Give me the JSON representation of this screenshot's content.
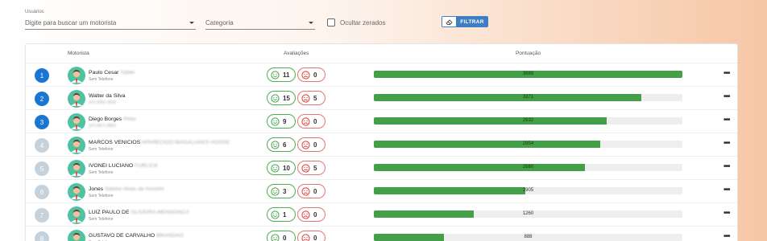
{
  "filters": {
    "users_label": "Usuários",
    "users_placeholder": "Digite para buscar um motorista",
    "category_placeholder": "Categoria",
    "hide_zero_label": "Ocultar zerados",
    "filter_button": "FILTRAR"
  },
  "table": {
    "headers": {
      "driver": "Motorista",
      "ratings": "Avaliações",
      "score": "Pontuação"
    },
    "max_score": 3889,
    "rows": [
      {
        "rank": "1",
        "name": "Paulo Cesar",
        "name_extra": "Tobler",
        "subtitle": "Sem Telefone",
        "subtitle_blurred": false,
        "good": "11",
        "bad": "0",
        "score": "3889",
        "score_value": 3889,
        "top": true
      },
      {
        "rank": "2",
        "name": "Walter da Silva",
        "name_extra": "",
        "subtitle": "(47) 9991-4520",
        "subtitle_blurred": true,
        "good": "15",
        "bad": "5",
        "score": "3371",
        "score_value": 3371,
        "top": true
      },
      {
        "rank": "3",
        "name": "Diego Borges",
        "name_extra": "Pinto",
        "subtitle": "(47) 9971-8820",
        "subtitle_blurred": true,
        "good": "9",
        "bad": "0",
        "score": "2932",
        "score_value": 2932,
        "top": true
      },
      {
        "rank": "4",
        "name": "MARCOS VENICIOS",
        "name_extra": "APARECIDO MAGALHAES HOSSE",
        "subtitle": "Sem Telefone",
        "subtitle_blurred": false,
        "good": "6",
        "bad": "0",
        "score": "2854",
        "score_value": 2854,
        "top": false
      },
      {
        "rank": "5",
        "name": "IVONEI LUCIANO",
        "name_extra": "FURLICK",
        "subtitle": "Sem Telefone",
        "subtitle_blurred": false,
        "good": "10",
        "bad": "5",
        "score": "2660",
        "score_value": 2660,
        "top": false
      },
      {
        "rank": "6",
        "name": "Jones",
        "name_extra": "Sabino Alves de Amorim",
        "subtitle": "Sem Telefone",
        "subtitle_blurred": false,
        "good": "3",
        "bad": "0",
        "score": "1905",
        "score_value": 1905,
        "top": false
      },
      {
        "rank": "7",
        "name": "LUIZ PAULO DE",
        "name_extra": "OLIVEIRA MENDONCA",
        "subtitle": "Sem Telefone",
        "subtitle_blurred": false,
        "good": "1",
        "bad": "0",
        "score": "1260",
        "score_value": 1260,
        "top": false
      },
      {
        "rank": "8",
        "name": "GUSTAVO DE CARVALHO",
        "name_extra": "BRANDAO",
        "subtitle": "Sem Telefone",
        "subtitle_blurred": false,
        "good": "0",
        "bad": "0",
        "score": "888",
        "score_value": 888,
        "top": false
      }
    ]
  },
  "colors": {
    "rank_top": "#1976d2",
    "rank_rest": "#c5d2dc",
    "bar_fill": "#43a047",
    "good_border": "#4caf50",
    "bad_border": "#e57373",
    "button": "#3d7fc2"
  },
  "icons": {
    "avatar": "driver-avatar-icon",
    "good": "smile-icon",
    "bad": "frown-icon",
    "filter_clear": "eraser-icon",
    "more": "more-horizontal-icon"
  }
}
